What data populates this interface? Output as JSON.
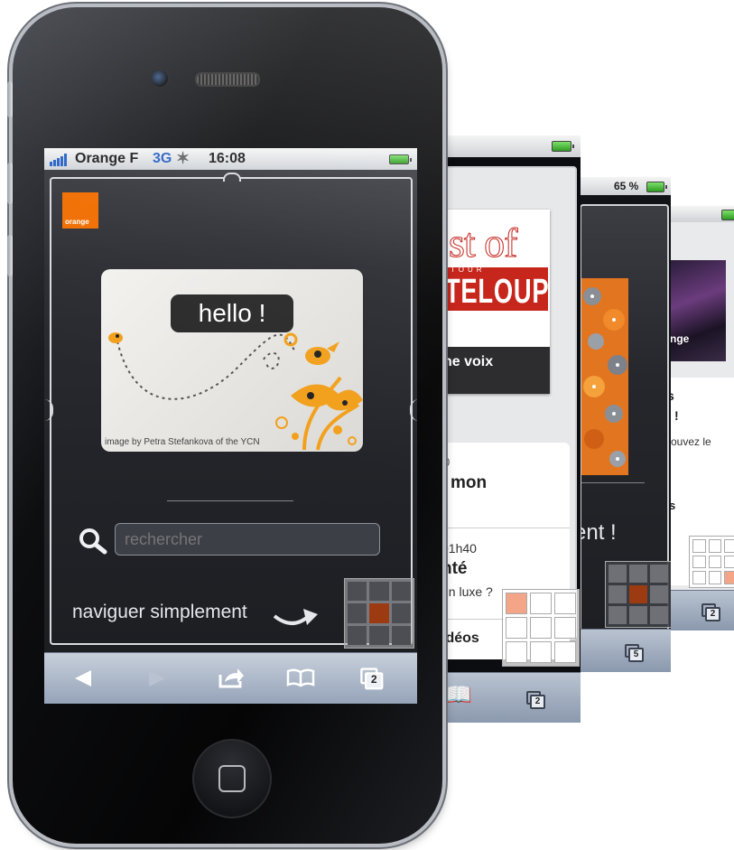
{
  "status_bar": {
    "carrier": "Orange F",
    "network": "3G",
    "time": "16:08"
  },
  "main_page": {
    "logo_text": "orange",
    "hello_text": "hello !",
    "image_credit": "image by Petra Stefankova of the YCN",
    "search_placeholder": "rechercher",
    "nav_text": "naviguer simplement"
  },
  "toolbar": {
    "tab_count": "2"
  },
  "back_page_1": {
    "title_line1": "st of",
    "title_line2": "TELOUP",
    "title_small": "TOUR",
    "caption": "he voix",
    "item1_time": "0",
    "item1_title": "mon",
    "item2_time": "01h40",
    "item2_title": "nté",
    "item2_sub": "un luxe ?",
    "item3_title": "idéos",
    "tab_count": "2"
  },
  "back_page_2": {
    "battery": "65 %",
    "text": "ent !",
    "tab_count": "5"
  },
  "back_page_3": {
    "image_label": "nge",
    "line1": "s",
    "line2": "!",
    "line3": "rouvez le",
    "line4": "s",
    "tab_count": "2"
  },
  "colors": {
    "orange": "#f16e00",
    "toolbar": "#a9b5c6",
    "grid_highlight": "#9c3a12",
    "grid_light": "#f5a587"
  }
}
